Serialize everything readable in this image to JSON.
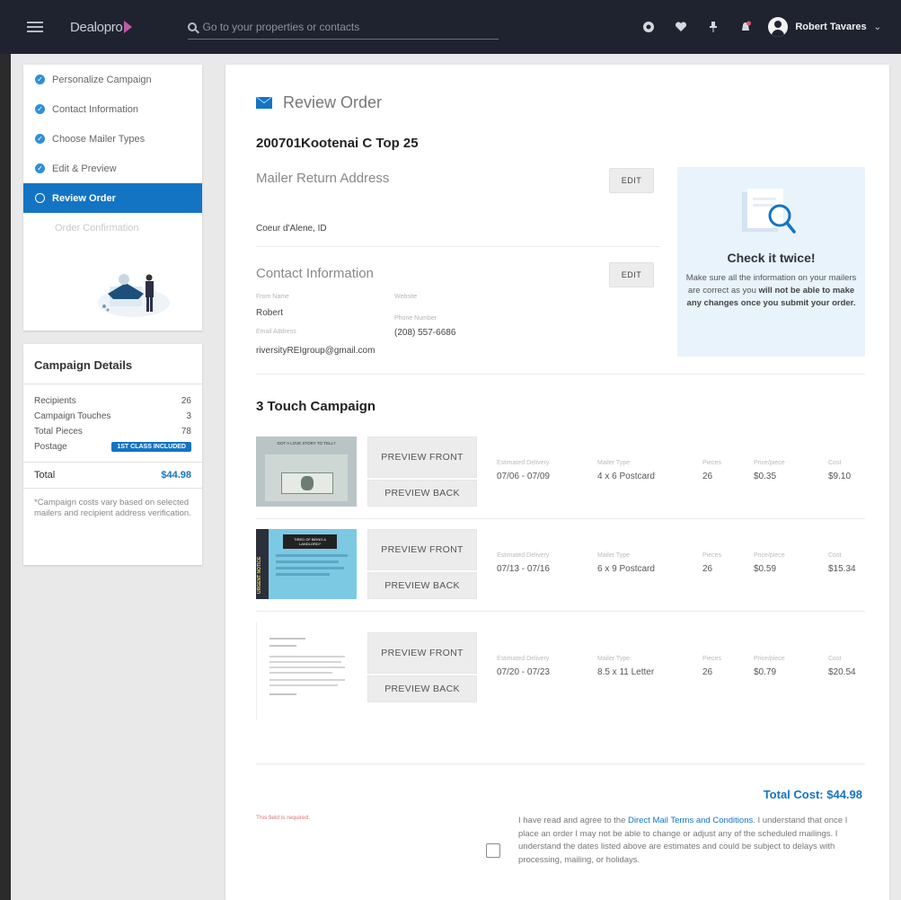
{
  "header": {
    "logo_text": "Dealopro",
    "search_placeholder": "Go to your properties or contacts",
    "user_name": "Robert Tavares"
  },
  "sidebar": {
    "steps": [
      {
        "label": "Personalize Campaign",
        "state": "done"
      },
      {
        "label": "Contact Information",
        "state": "done"
      },
      {
        "label": "Choose Mailer Types",
        "state": "done"
      },
      {
        "label": "Edit & Preview",
        "state": "done"
      },
      {
        "label": "Review Order",
        "state": "active"
      },
      {
        "label": "Order Confirmation",
        "state": "disabled"
      }
    ]
  },
  "details": {
    "title": "Campaign Details",
    "rows": [
      {
        "label": "Recipients",
        "value": "26"
      },
      {
        "label": "Campaign Touches",
        "value": "3"
      },
      {
        "label": "Total Pieces",
        "value": "78"
      },
      {
        "label": "Postage",
        "badge": "1ST CLASS INCLUDED"
      }
    ],
    "total_label": "Total",
    "total_value": "$44.98",
    "note": "*Campaign costs vary based on selected mailers and recipient address verification."
  },
  "main": {
    "heading": "Review Order",
    "campaign_name": "200701Kootenai C Top 25",
    "return_address": {
      "title": "Mailer Return Address",
      "edit_label": "EDIT",
      "address": "Coeur d'Alene, ID"
    },
    "contact": {
      "title": "Contact Information",
      "edit_label": "EDIT",
      "name_label": "From Name",
      "name_value": "Robert",
      "website_label": "Website",
      "email_label": "Email Address",
      "email_value": "riversityREIgroup@gmail.com",
      "phone_label": "Phone Number",
      "phone_value": "(208) 557-6686"
    },
    "tip": {
      "title": "Check it twice!",
      "text_plain": "Make sure all the information on your mailers are correct as you",
      "text_bold": "will not be able to make any changes once you submit your order."
    },
    "touch_title": "3 Touch Campaign",
    "col_labels": {
      "delivery": "Estimated Delivery",
      "type": "Mailer Type",
      "pieces": "Pieces",
      "price": "Price/piece",
      "cost": "Cost"
    },
    "preview_front": "PREVIEW FRONT",
    "preview_back": "PREVIEW BACK",
    "mailers": [
      {
        "thumb_title": "GOT A LOVE STORY TO TELL?",
        "delivery": "07/06 - 07/09",
        "type": "4 x 6 Postcard",
        "pieces": "26",
        "price": "$0.35",
        "cost": "$9.10"
      },
      {
        "thumb_title": "TIRED OF BEING A LANDLORD?",
        "thumb_side": "URGENT NOTICE",
        "delivery": "07/13 - 07/16",
        "type": "6 x 9 Postcard",
        "pieces": "26",
        "price": "$0.59",
        "cost": "$15.34"
      },
      {
        "delivery": "07/20 - 07/23",
        "type": "8.5 x 11 Letter",
        "pieces": "26",
        "price": "$0.79",
        "cost": "$20.54"
      }
    ],
    "total_cost": "Total Cost: $44.98",
    "required_text": "This field is required.",
    "agree_prefix": "I have read and agree to the ",
    "agree_link": "Direct Mail Terms and Conditions",
    "agree_suffix": ". I understand that once I place an order I may not be able to change or adjust any of the scheduled mailings. I understand the dates listed above are estimates and could be subject to delays with processing, mailing, or holidays."
  }
}
